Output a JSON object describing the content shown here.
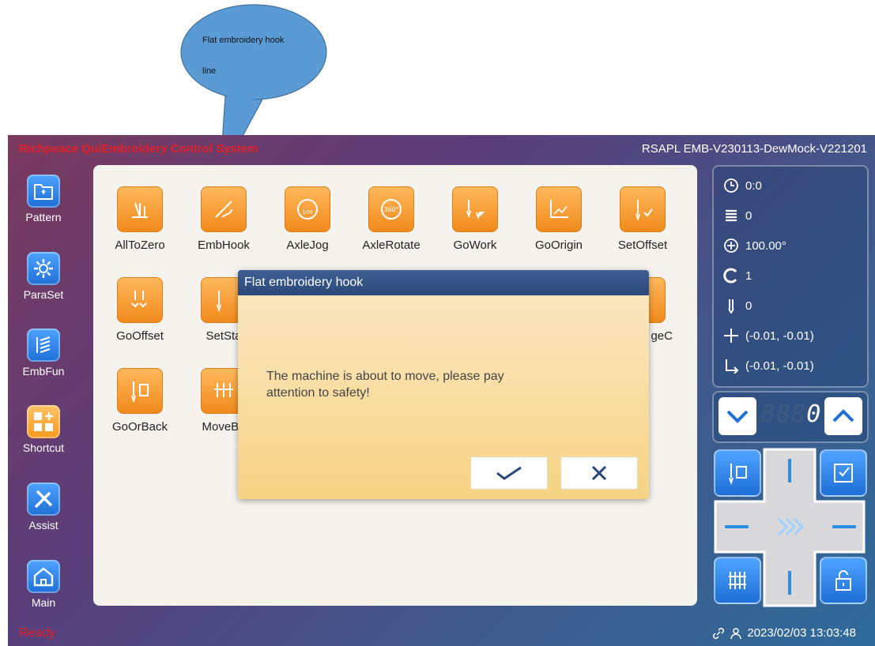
{
  "callout": {
    "line1": "Flat embroidery hook",
    "line2": "line"
  },
  "header": {
    "title": "Richpeace QuiEmbroidery Control System",
    "version": "RSAPL EMB-V230113-DewMock-V221201"
  },
  "sidebar": {
    "items": [
      {
        "label": "Pattern",
        "icon": "folder-icon"
      },
      {
        "label": "ParaSet",
        "icon": "gear-icon"
      },
      {
        "label": "EmbFun",
        "icon": "embroidery-icon"
      },
      {
        "label": "Shortcut",
        "icon": "grid-plus-icon"
      },
      {
        "label": "Assist",
        "icon": "tools-icon"
      },
      {
        "label": "Main",
        "icon": "home-icon"
      }
    ]
  },
  "functions": {
    "items": [
      {
        "label": "AllToZero"
      },
      {
        "label": "EmbHook"
      },
      {
        "label": "AxleJog"
      },
      {
        "label": "AxleRotate"
      },
      {
        "label": "GoWork"
      },
      {
        "label": "GoOrigin"
      },
      {
        "label": "SetOffset"
      },
      {
        "label": "GoOffset"
      },
      {
        "label": "SetSta"
      },
      {
        "label": "geC"
      },
      {
        "label": "GoOrBack"
      },
      {
        "label": "MoveBo"
      }
    ]
  },
  "info": {
    "time": "0:0",
    "stitches": "0",
    "angle": "100.00°",
    "color": "1",
    "needle": "0",
    "position": "(-0.01, -0.01)",
    "offset": "(-0.01, -0.01)"
  },
  "counter": {
    "ghost": "888",
    "value": "0"
  },
  "dialog": {
    "title": "Flat embroidery hook",
    "message": "The machine is about to move, please pay attention to safety!"
  },
  "status": {
    "left": "Ready",
    "datetime": "2023/02/03 13:03:48"
  },
  "colors": {
    "accent": "#f59a1e",
    "danger": "#e0202a",
    "primary": "#1f6fd6"
  }
}
